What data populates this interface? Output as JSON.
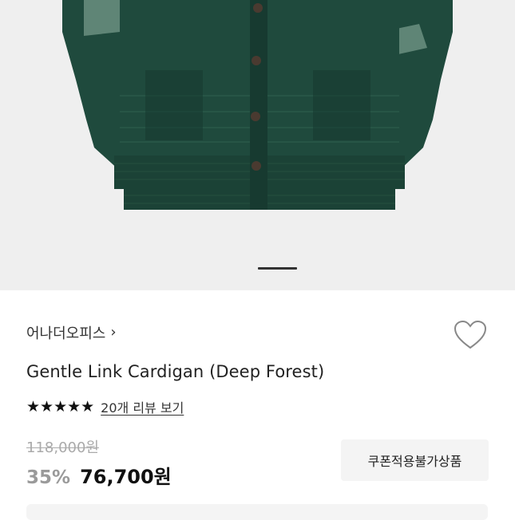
{
  "gallery": {
    "image_alt": "Gentle Link Cardigan (Deep Forest) product photo",
    "colors": {
      "background": "#efefef",
      "knit": "#1f4a3d",
      "knit_dark": "#173a30",
      "patch": "#6b8f80",
      "button": "#4a3a30"
    },
    "indicator_icon": "page-indicator"
  },
  "product": {
    "brand": "어나더오피스",
    "brand_chevron": "›",
    "title": "Gentle Link Cardigan (Deep Forest)",
    "rating_stars": "★★★★★",
    "rating_value": 5,
    "reviews_link": "20개 리뷰 보기",
    "original_price": "118,000원",
    "discount": "35%",
    "price": "76,700원",
    "coupon_button": "쿠폰적용불가상품",
    "wishlist_icon": "heart-outline-icon"
  }
}
